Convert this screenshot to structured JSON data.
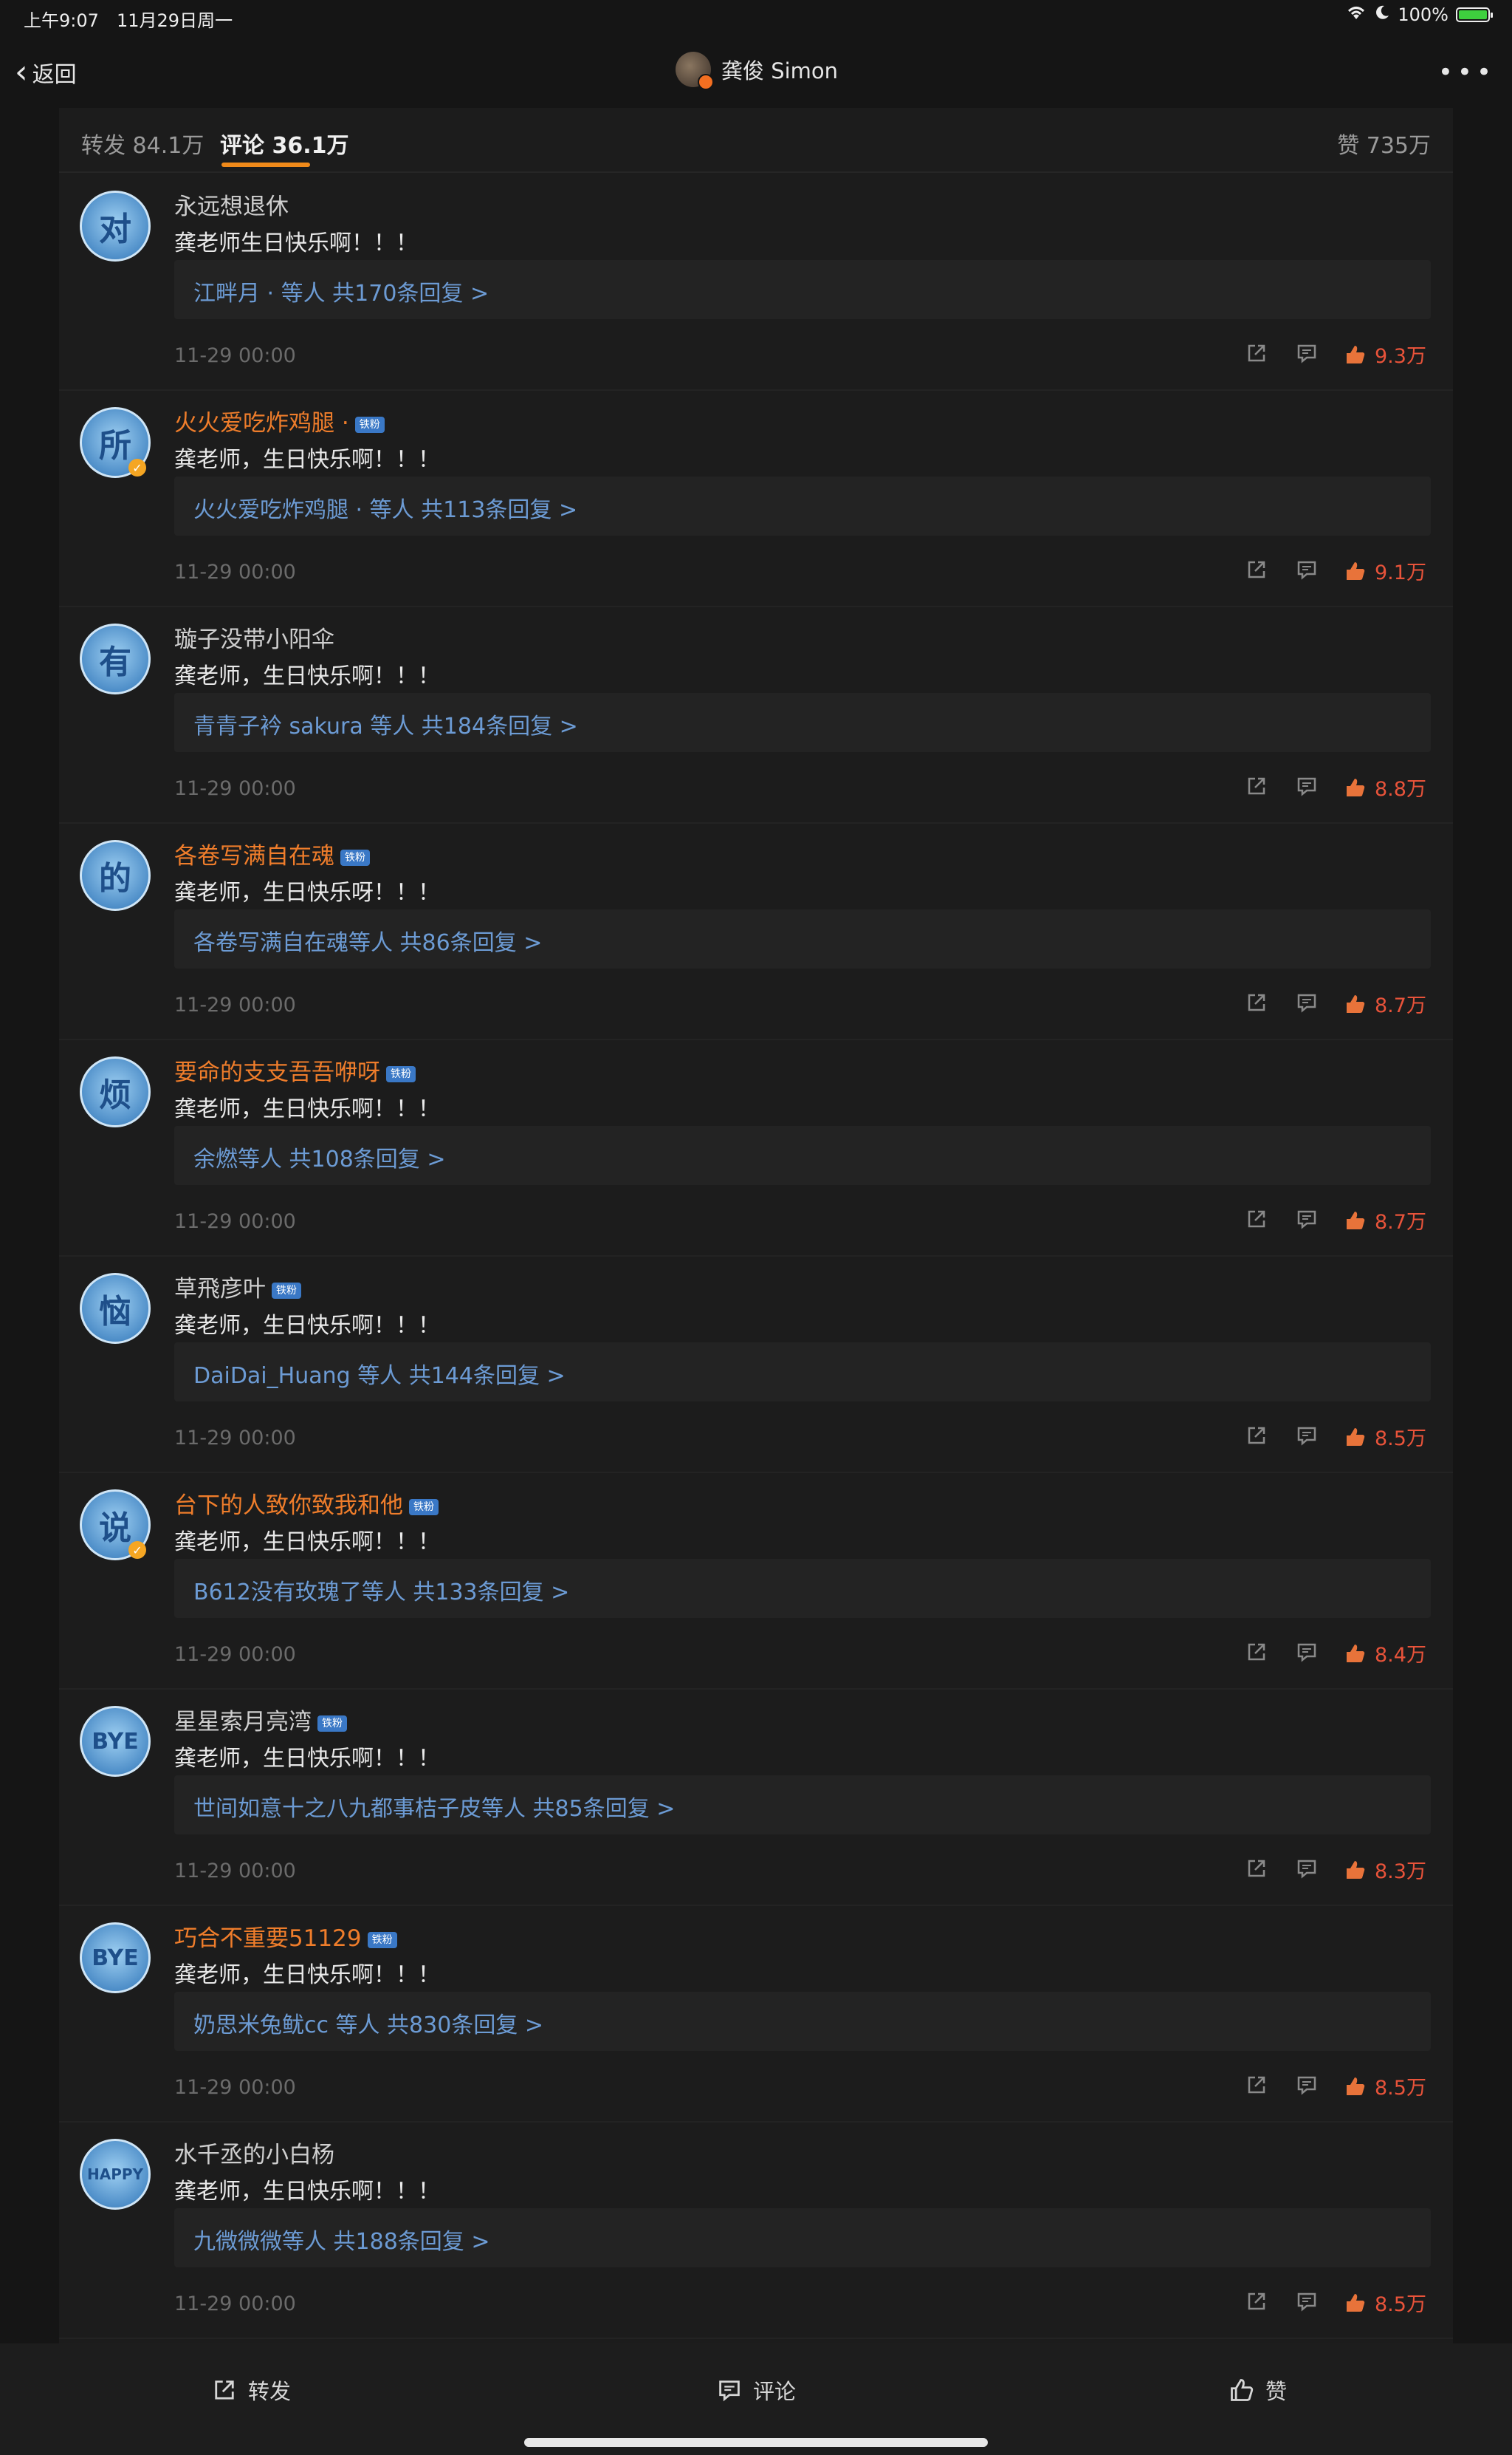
{
  "status_bar": {
    "time": "上午9:07",
    "date": "11月29日周一",
    "battery": "100%"
  },
  "nav": {
    "back_label": "返回",
    "title": "龚俊 Simon"
  },
  "tabs": {
    "repost": "转发 84.1万",
    "comments": "评论 36.1万",
    "likes": "赞 735万"
  },
  "comments": [
    {
      "avatar_char": "对",
      "user": "永远想退休",
      "orange": false,
      "badge": "",
      "verified": false,
      "text": "龚老师生日快乐啊！！！",
      "replies": "江畔月 · 等人  共170条回复 >",
      "time": "11-29 00:00",
      "likes": "9.3万"
    },
    {
      "avatar_char": "所",
      "user": "火火爱吃炸鸡腿 ·",
      "orange": true,
      "badge": "铁粉",
      "verified": true,
      "text": "龚老师，生日快乐啊！！！",
      "replies": "火火爱吃炸鸡腿 · 等人  共113条回复 >",
      "time": "11-29 00:00",
      "likes": "9.1万"
    },
    {
      "avatar_char": "有",
      "user": "璇子没带小阳伞",
      "orange": false,
      "badge": "",
      "verified": false,
      "text": "龚老师，生日快乐啊！！！",
      "replies": "青青子衿 sakura 等人  共184条回复 >",
      "time": "11-29 00:00",
      "likes": "8.8万"
    },
    {
      "avatar_char": "的",
      "user": "各卷写满自在魂",
      "orange": true,
      "badge": "铁粉",
      "verified": false,
      "text": "龚老师，生日快乐呀！！！",
      "replies": "各卷写满自在魂等人  共86条回复 >",
      "time": "11-29 00:00",
      "likes": "8.7万"
    },
    {
      "avatar_char": "烦",
      "user": "要命的支支吾吾咿呀",
      "orange": true,
      "badge": "铁粉",
      "verified": false,
      "text": "龚老师，生日快乐啊！！！",
      "replies": "余燃等人  共108条回复 >",
      "time": "11-29 00:00",
      "likes": "8.7万"
    },
    {
      "avatar_char": "恼",
      "user": "草飛彦叶",
      "orange": false,
      "badge": "铁粉",
      "verified": false,
      "text": "龚老师，生日快乐啊！！！",
      "replies": "DaiDai_Huang 等人  共144条回复 >",
      "time": "11-29 00:00",
      "likes": "8.5万"
    },
    {
      "avatar_char": "说",
      "user": "台下的人致你致我和他",
      "orange": true,
      "badge": "铁粉",
      "verified": true,
      "text": "龚老师，生日快乐啊！！！",
      "replies": "B612没有玫瑰了等人  共133条回复 >",
      "time": "11-29 00:00",
      "likes": "8.4万"
    },
    {
      "avatar_char": "BYE",
      "user": "星星索月亮湾",
      "orange": false,
      "badge": "铁粉",
      "verified": false,
      "text": "龚老师，生日快乐啊！！！",
      "replies": "世间如意十之八九都事桔子皮等人  共85条回复 >",
      "time": "11-29 00:00",
      "likes": "8.3万"
    },
    {
      "avatar_char": "BYE",
      "user": "巧合不重要51129",
      "orange": true,
      "badge": "铁粉",
      "verified": false,
      "text": "龚老师，生日快乐啊！！！",
      "replies": "奶思米兔鱿cc 等人  共830条回复 >",
      "time": "11-29 00:00",
      "likes": "8.5万"
    },
    {
      "avatar_char": "HAPPY",
      "user": "水千丞的小白杨",
      "orange": false,
      "badge": "",
      "verified": false,
      "text": "龚老师，生日快乐啊！！！",
      "replies": "九微微微等人  共188条回复 >",
      "time": "11-29 00:00",
      "likes": "8.5万"
    }
  ],
  "toolbar": {
    "repost": "转发",
    "comment": "评论",
    "like": "赞"
  },
  "colors": {
    "accent": "#f08a1a",
    "link": "#6c9bd4",
    "like": "#e8533a",
    "username_highlight": "#ef7d2b"
  }
}
